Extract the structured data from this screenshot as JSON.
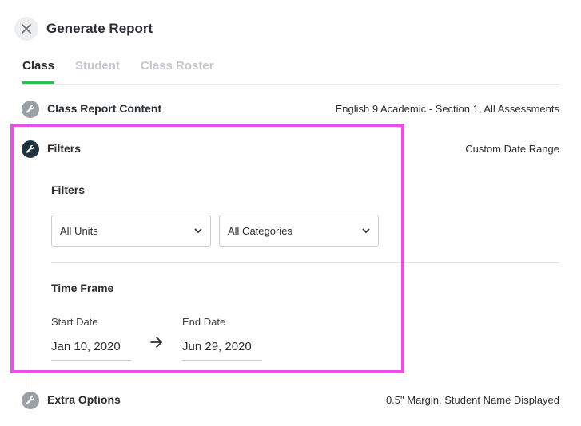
{
  "header": {
    "title": "Generate Report",
    "close_icon": "close-icon"
  },
  "tabs": [
    {
      "label": "Class",
      "active": true
    },
    {
      "label": "Student",
      "active": false
    },
    {
      "label": "Class Roster",
      "active": false
    }
  ],
  "steps": {
    "content": {
      "label": "Class Report Content",
      "summary": "English 9 Academic - Section 1, All Assessments",
      "icon": "wrench-icon"
    },
    "filters": {
      "label": "Filters",
      "summary": "Custom Date Range",
      "icon": "wrench-icon"
    },
    "extra": {
      "label": "Extra Options",
      "summary": "0.5\" Margin, Student Name Displayed",
      "icon": "wrench-icon"
    }
  },
  "filters_panel": {
    "heading": "Filters",
    "units_select": {
      "value": "All Units"
    },
    "categories_select": {
      "value": "All Categories"
    }
  },
  "time_frame": {
    "heading": "Time Frame",
    "start_label": "Start Date",
    "start_value": "Jan 10, 2020",
    "end_label": "End Date",
    "end_value": "Jun 29, 2020"
  },
  "colors": {
    "accent": "#2bbf4e",
    "highlight": "#ec4fe8",
    "active_step": "#1f3440",
    "inactive_step": "#9ba0a6"
  }
}
